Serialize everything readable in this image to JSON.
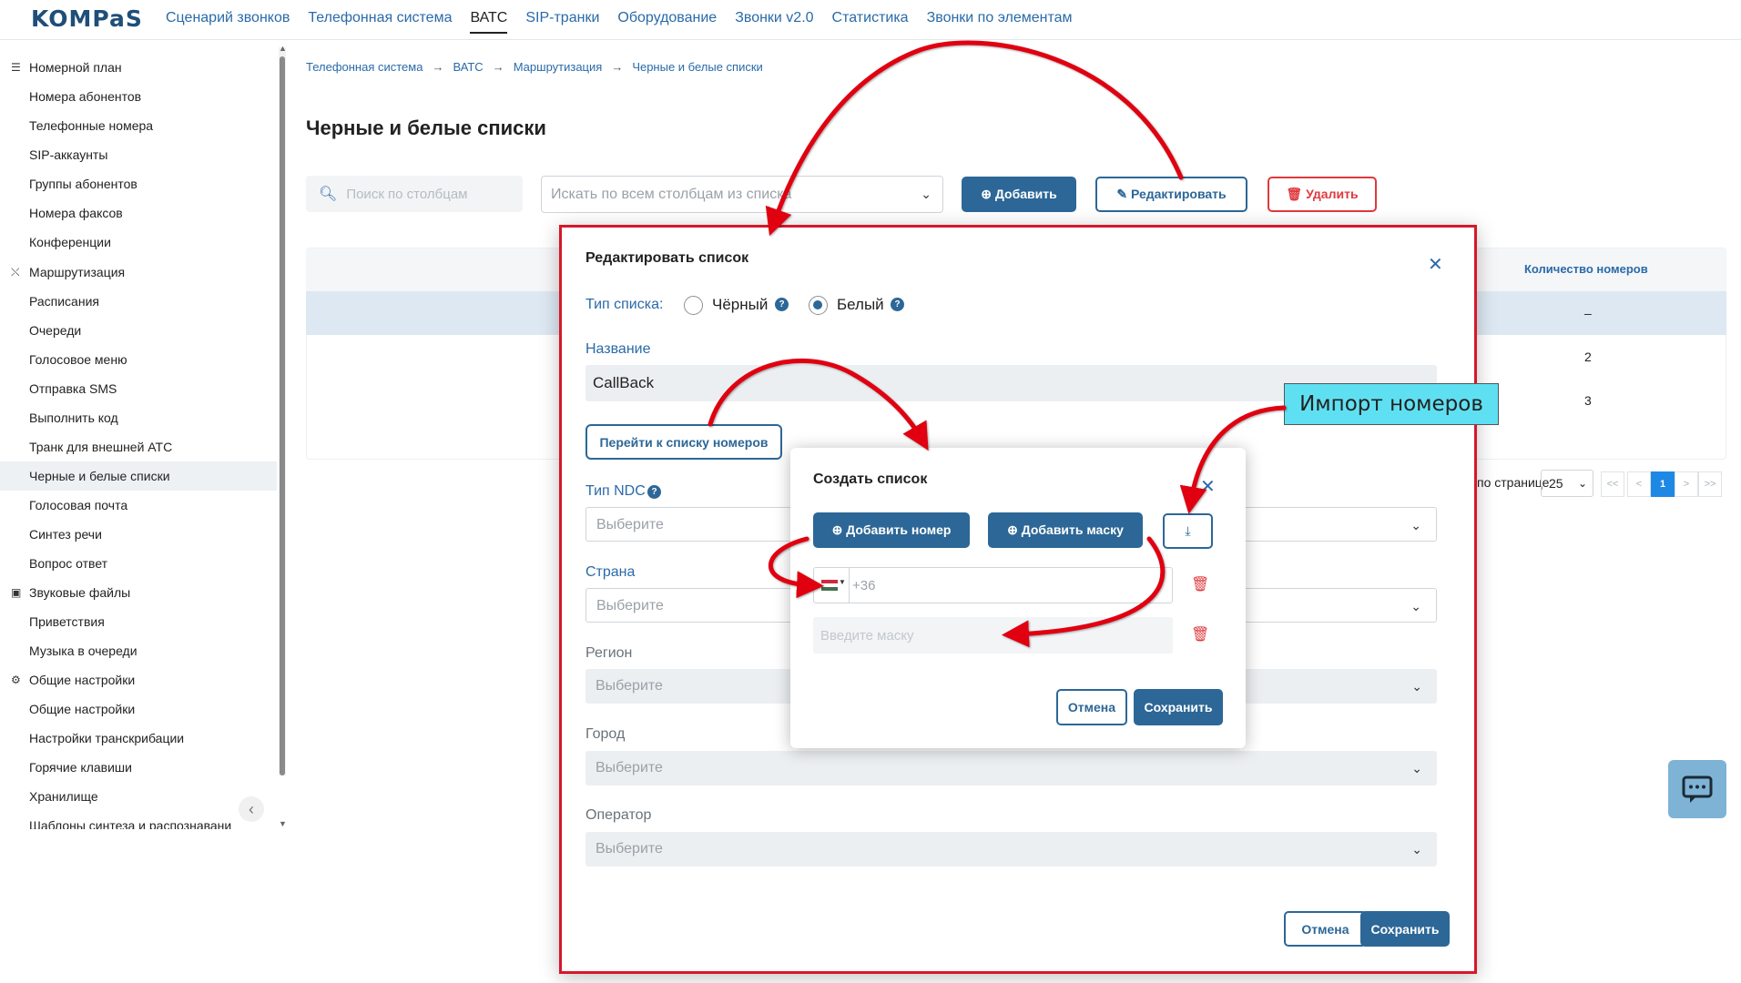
{
  "app": {
    "logo": "KOMPaS",
    "nav": [
      "Сценарий звонков",
      "Телефонная система",
      "ВАТС",
      "SIP-транки",
      "Оборудование",
      "Звонки v2.0",
      "Статистика",
      "Звонки по элементам"
    ]
  },
  "sidebar": {
    "groups": [
      {
        "label": "Номерной план",
        "icon": "list-icon",
        "items": [
          "Номера абонентов",
          "Телефонные номера",
          "SIP-аккаунты",
          "Группы абонентов",
          "Номера факсов",
          "Конференции"
        ]
      },
      {
        "label": "Маршрутизация",
        "icon": "routing-icon",
        "items": [
          "Расписания",
          "Очереди",
          "Голосовое меню",
          "Отправка SMS",
          "Выполнить код",
          "Транк для внешней АТС",
          "Черные и белые списки",
          "Голосовая почта",
          "Синтез речи",
          "Вопрос ответ"
        ]
      },
      {
        "label": "Звуковые файлы",
        "icon": "audio-files-icon",
        "items": [
          "Приветствия",
          "Музыка в очереди"
        ]
      },
      {
        "label": "Общие настройки",
        "icon": "gear-icon",
        "items": [
          "Общие настройки",
          "Настройки транскрибации",
          "Горячие клавиши",
          "Хранилище",
          "Шаблоны синтеза и распознавани"
        ]
      }
    ],
    "selected_item": "Черные и белые списки"
  },
  "breadcrumb": [
    "Телефонная система",
    "ВАТС",
    "Маршрутизация",
    "Черные и белые списки"
  ],
  "page": {
    "title": "Черные и белые списки",
    "search_placeholder": "Поиск по столбцам",
    "search_scope": "Искать по всем столбцам из списка",
    "buttons": {
      "add": "Добавить",
      "edit": "Редактировать",
      "delete": "Удалить"
    }
  },
  "table": {
    "count_header": "Количество номеров",
    "rows": [
      {
        "count": "–"
      },
      {
        "count": "2"
      },
      {
        "count": "3"
      }
    ]
  },
  "pagination": {
    "per_page_label": "по странице",
    "per_page": "25",
    "current_page": "1",
    "first": "<<",
    "prev": "<",
    "next": ">",
    "last": ">>"
  },
  "edit_dialog": {
    "title": "Редактировать список",
    "list_type_label": "Тип списка:",
    "type_black": "Чёрный",
    "type_white": "Белый",
    "selected_type": "white",
    "name_label": "Название",
    "name_value": "CallBack",
    "goto_button": "Перейти к списку номеров",
    "ndc_label": "Тип NDC",
    "country_label": "Страна",
    "region_label": "Регион",
    "city_label": "Город",
    "operator_label": "Оператор",
    "select_placeholder": "Выберите",
    "cancel": "Отмена",
    "save": "Сохранить"
  },
  "create_dialog": {
    "title": "Создать список",
    "add_number": "Добавить номер",
    "add_mask": "Добавить маску",
    "phone_placeholder": "+36",
    "mask_placeholder": "Введите маску",
    "cancel": "Отмена",
    "save": "Сохранить"
  },
  "annotation": {
    "callout": "Импорт номеров",
    "color": "#5fe0f2",
    "arrow_color": "#e00010"
  },
  "colors": {
    "primary": "#2c6797",
    "danger": "#e0393e",
    "link": "#2a6aa8",
    "highlight_border": "#d5182a"
  }
}
